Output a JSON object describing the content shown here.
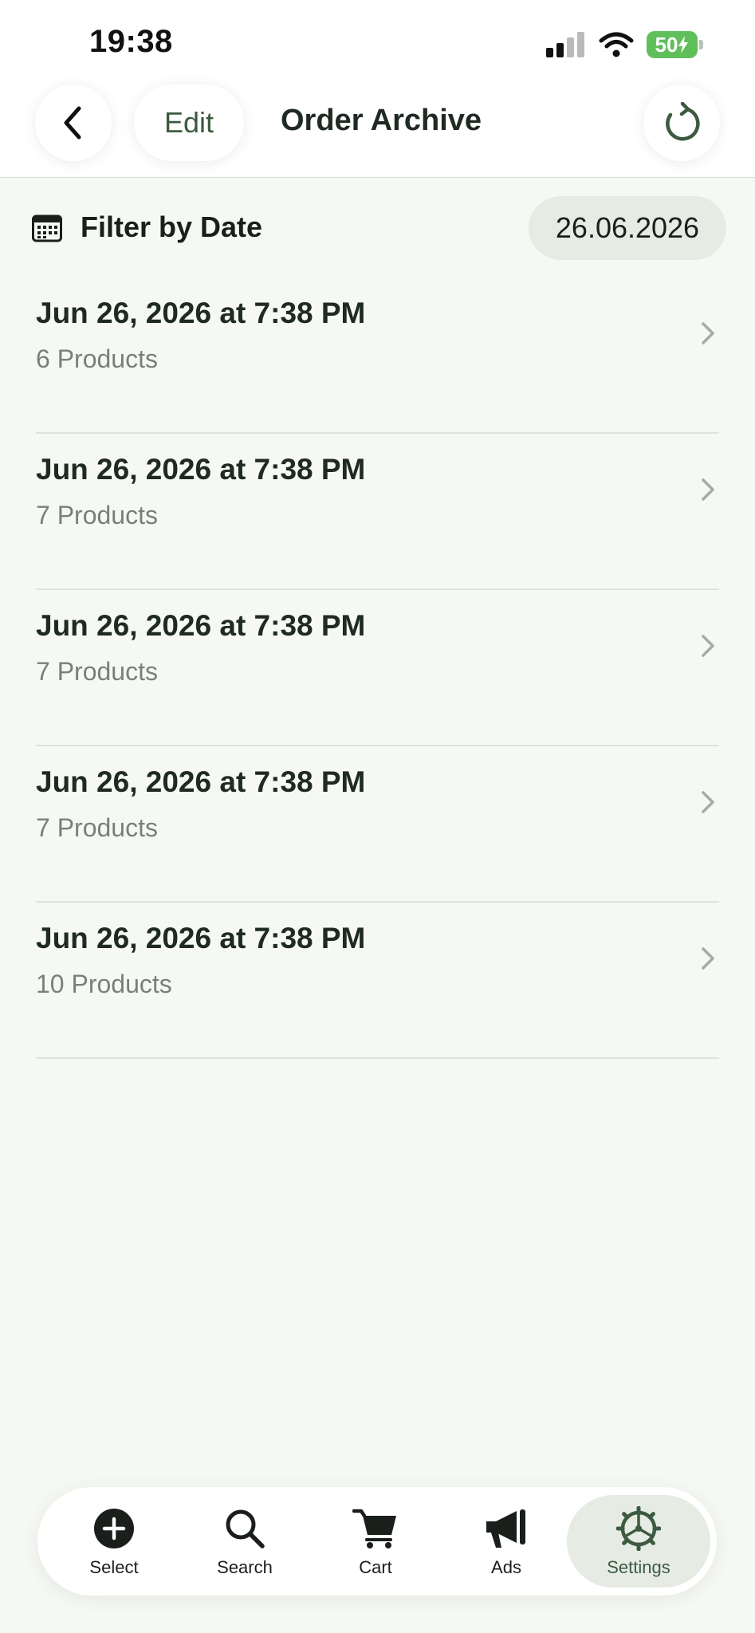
{
  "status_bar": {
    "time": "19:38",
    "battery": "50"
  },
  "header": {
    "title": "Order Archive",
    "edit_label": "Edit",
    "back_icon": "chevron-left-icon",
    "refresh_icon": "refresh-icon"
  },
  "filter": {
    "label": "Filter by Date",
    "date_value": "26.06.2026",
    "icon": "calendar-icon"
  },
  "orders": [
    {
      "title": "Jun 26, 2026 at 7:38 PM",
      "products": "6 Products"
    },
    {
      "title": "Jun 26, 2026 at 7:38 PM",
      "products": "7 Products"
    },
    {
      "title": "Jun 26, 2026 at 7:38 PM",
      "products": "7 Products"
    },
    {
      "title": "Jun 26, 2026 at 7:38 PM",
      "products": "7 Products"
    },
    {
      "title": "Jun 26, 2026 at 7:38 PM",
      "products": "10 Products"
    }
  ],
  "tabs": [
    {
      "label": "Select",
      "icon": "plus-circle-icon",
      "active": false
    },
    {
      "label": "Search",
      "icon": "search-icon",
      "active": false
    },
    {
      "label": "Cart",
      "icon": "cart-icon",
      "active": false
    },
    {
      "label": "Ads",
      "icon": "megaphone-icon",
      "active": false
    },
    {
      "label": "Settings",
      "icon": "gear-icon",
      "active": true
    }
  ],
  "colors": {
    "background": "#f6f9f3",
    "accent": "#3c5a3f",
    "pill": "#e6ebe4",
    "battery": "#5fbf5a"
  }
}
